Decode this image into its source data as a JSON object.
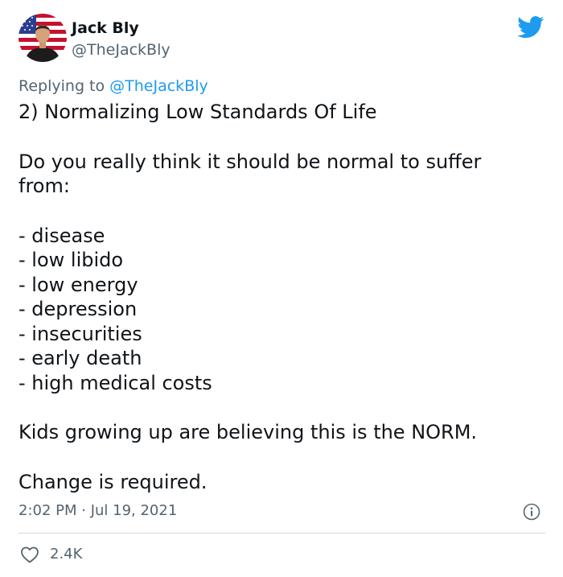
{
  "author": {
    "name": "Jack Bly",
    "handle": "@TheJackBly"
  },
  "reply": {
    "prefix": "Replying to ",
    "mention": "@TheJackBly"
  },
  "body": {
    "title": "2) Normalizing Low Standards Of Life",
    "question_line1": "Do you really think it should be normal to suffer",
    "question_line2": "from:",
    "list": [
      "- disease",
      "- low libido",
      "- low energy",
      "- depression",
      "- insecurities",
      "- early death",
      "- high medical costs"
    ],
    "statement": "Kids growing up are believing this is the NORM.",
    "closing": "Change is required."
  },
  "meta": {
    "timestamp": "2:02 PM · Jul 19, 2021"
  },
  "actions": {
    "likes": "2.4K"
  },
  "icons": {
    "brand": "twitter-bird-icon",
    "info": "info-icon",
    "like": "heart-icon"
  },
  "colors": {
    "brand_blue": "#1d9bf0",
    "text_primary": "#0f1419",
    "text_secondary": "#536471",
    "divider": "#cfd9de"
  }
}
